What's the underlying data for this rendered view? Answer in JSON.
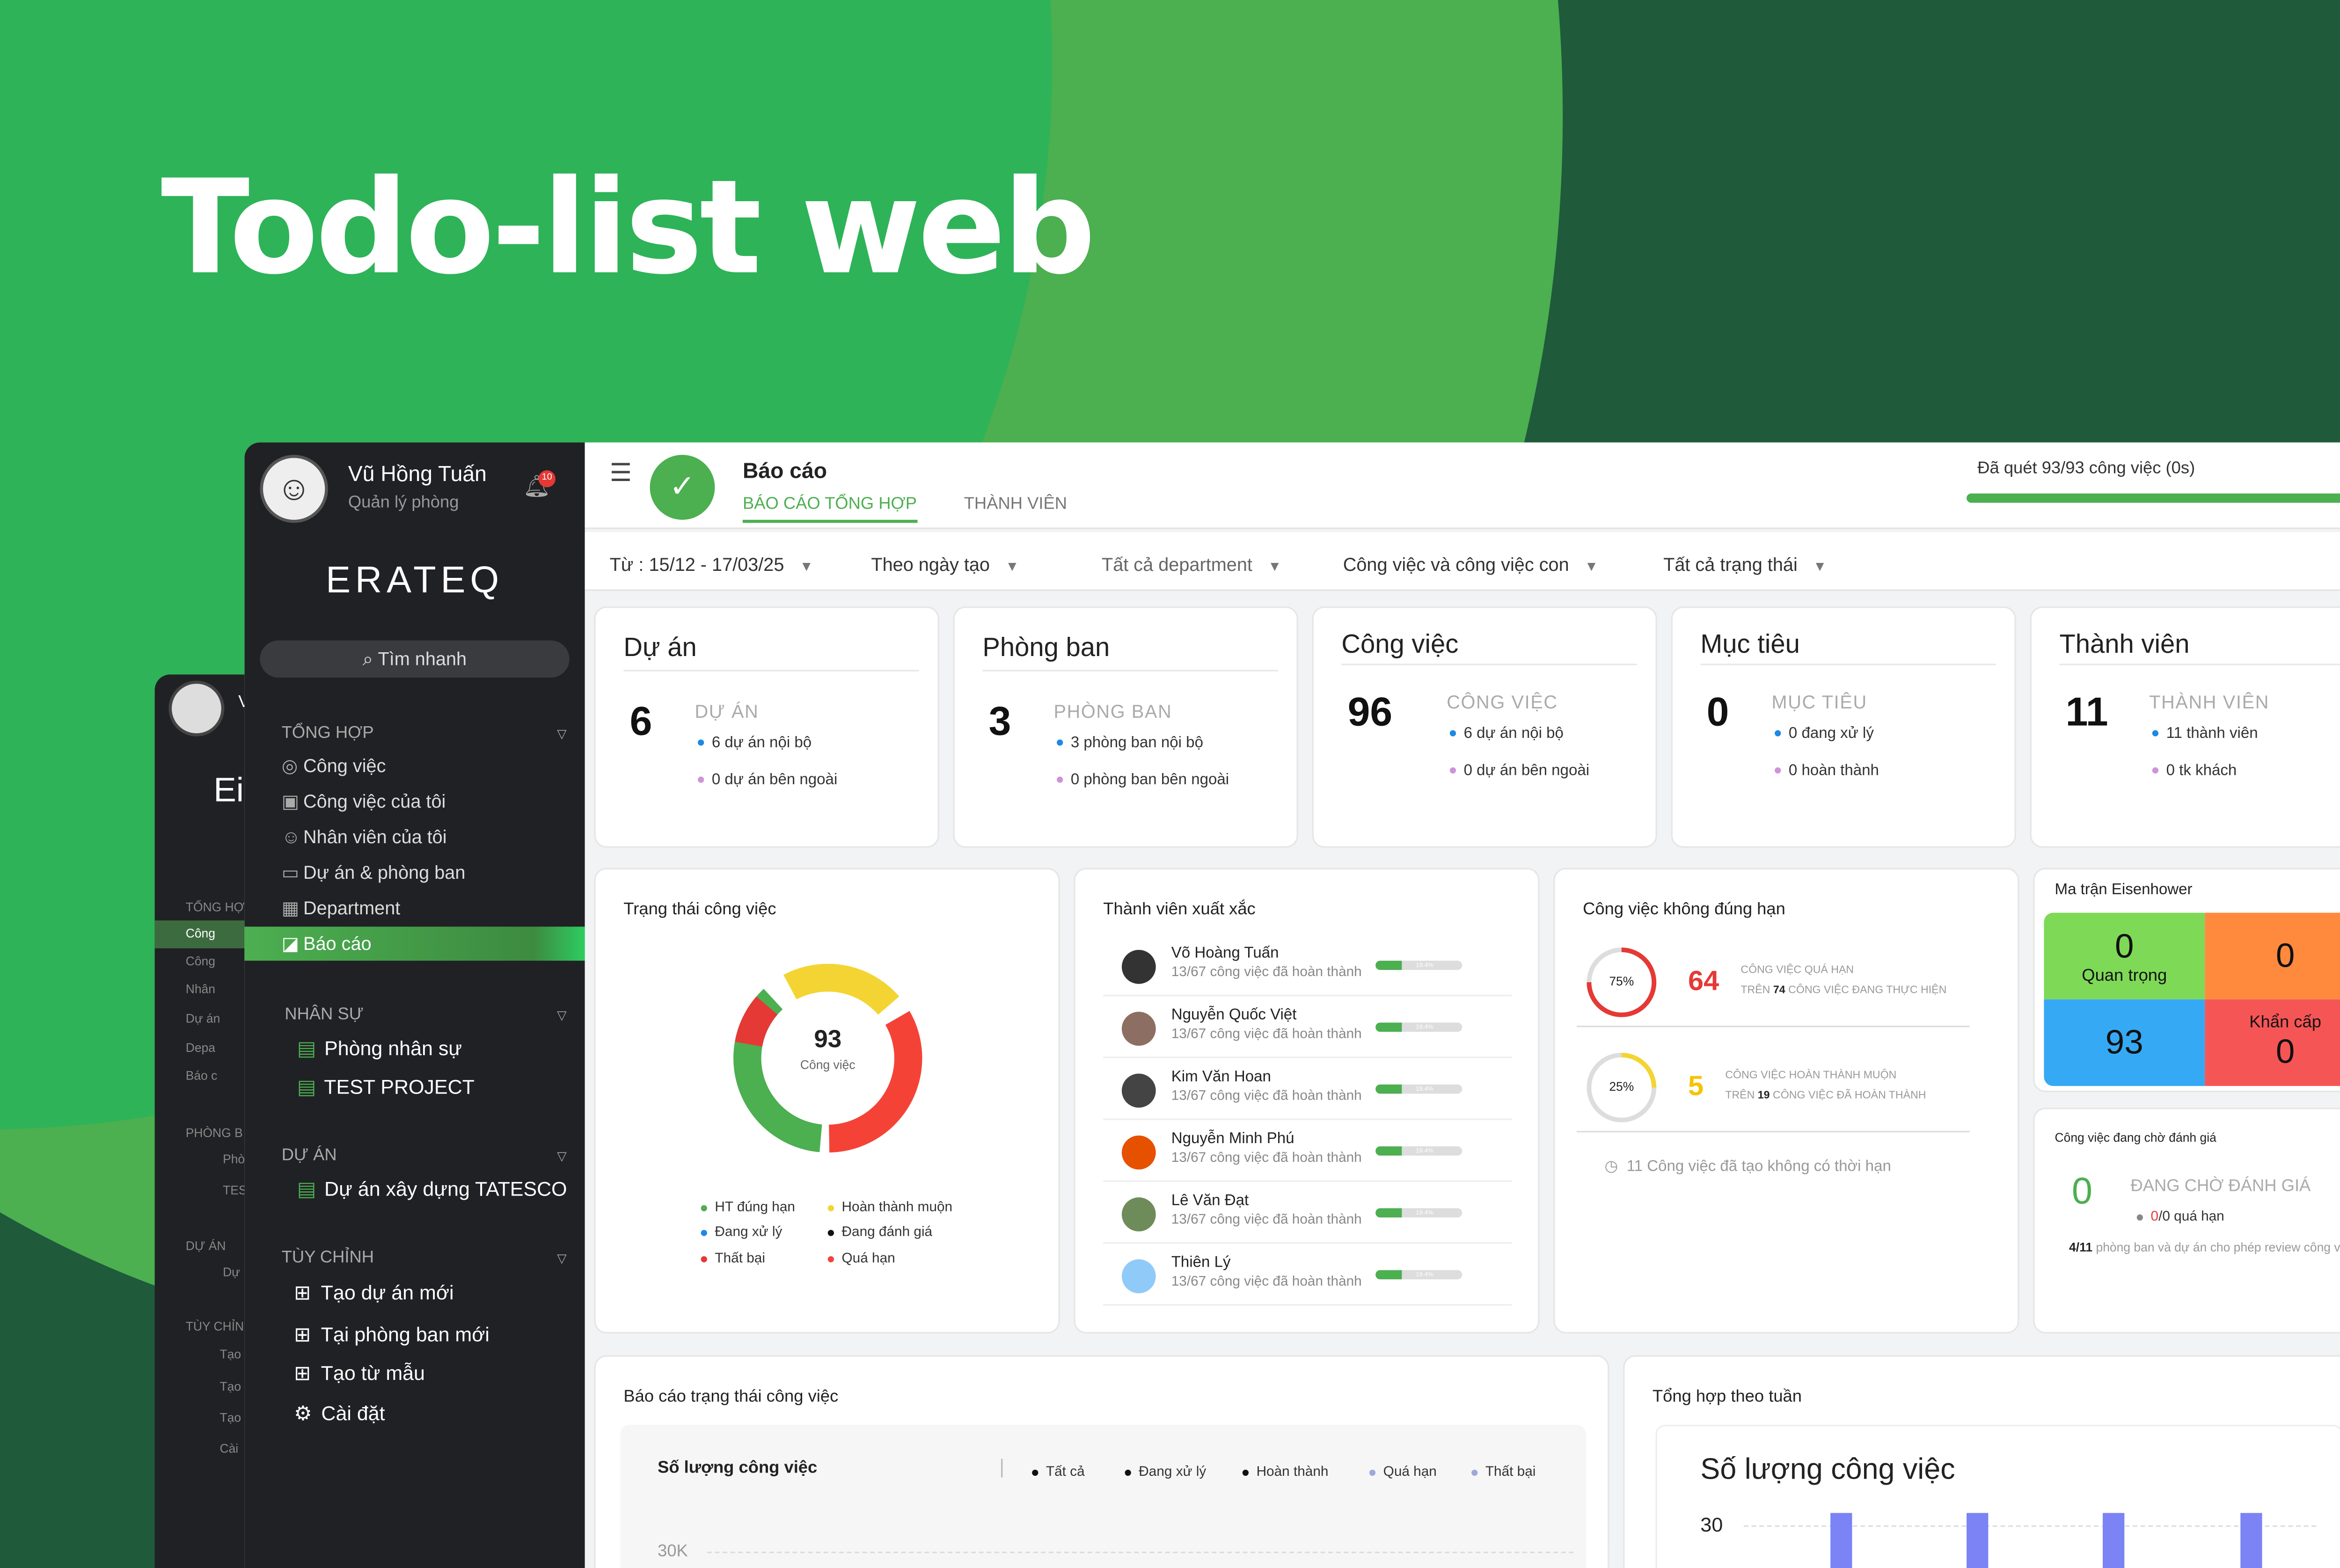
{
  "hero_title": "Todo-list web",
  "back_window": {
    "labels": [
      "Vi",
      "Ei",
      "TỔNG HỢ",
      "Công",
      "Công",
      "Nhân",
      "Dự án",
      "Depa",
      "Báo c",
      "PHÒNG B",
      "Phò",
      "TES",
      "DỰ ÁN",
      "Dự",
      "TÙY CHỈN",
      "Tạo",
      "Tạo",
      "Tạo",
      "Cài"
    ]
  },
  "user": {
    "name": "Vũ Hồng Tuấn",
    "role": "Quản lý phòng",
    "avatar_icon": "cartoon-face-avatar",
    "notif_count": "10"
  },
  "brand": "ERATEQ",
  "search_label": "Tìm nhanh",
  "sidebar": {
    "section_general": "TỔNG HỢP",
    "general_items": [
      "Công việc",
      "Công việc của tôi",
      "Nhân viên của tôi",
      "Dự án & phòng ban",
      "Department",
      "Báo cáo"
    ],
    "section_hr": "NHÂN SỰ",
    "hr_items": [
      "Phòng nhân sự",
      "TEST PROJECT"
    ],
    "section_projects": "DỰ ÁN",
    "project_items": [
      "Dự án xây dựng TATESCO"
    ],
    "section_custom": "TÙY CHỈNH",
    "custom_items": [
      "Tạo dự án mới",
      "Tại phòng ban mới",
      "Tạo từ mẫu",
      "Cài đặt"
    ]
  },
  "header": {
    "title": "Báo cáo",
    "tabs": [
      "BÁO CÁO TỔNG HỢP",
      "THÀNH VIÊN"
    ],
    "scan_status": "Đã quét 93/93 công việc (0s)",
    "scan_progress": 1.0
  },
  "filters": {
    "date_range": "Từ : 15/12 - 17/03/25",
    "date_type": "Theo ngày tạo",
    "department": "Tất cả department",
    "task_scope": "Công việc và công việc con",
    "status": "Tất cả trạng thái"
  },
  "stats": [
    {
      "title": "Dự án",
      "num": "6",
      "label": "DỰ ÁN",
      "s1": "6 dự án nội bộ",
      "s2": "0 dự án bên ngoài"
    },
    {
      "title": "Phòng ban",
      "num": "3",
      "label": "PHÒNG BAN",
      "s1": "3 phòng ban nội bộ",
      "s2": "0 phòng ban bên ngoài"
    },
    {
      "title": "Công việc",
      "num": "96",
      "label": "CÔNG VIỆC",
      "s1": "6 dự án nội bộ",
      "s2": "0 dự án bên ngoài"
    },
    {
      "title": "Mục tiêu",
      "num": "0",
      "label": "MỤC TIÊU",
      "s1": "0 đang xử lý",
      "s2": "0 hoàn thành"
    },
    {
      "title": "Thành viên",
      "num": "11",
      "label": "THÀNH VIÊN",
      "s1": "11 thành viên",
      "s2": "0 tk khách"
    }
  ],
  "task_status": {
    "title": "Trạng thái công việc",
    "total": "93",
    "total_label": "Công việc",
    "legend": [
      "HT đúng hạn",
      "Hoàn thành muộn",
      "Đang xử lý",
      "Đang đánh giá",
      "Thất bại",
      "Quá hạn"
    ],
    "colors": {
      "on_time": "#4caf50",
      "late": "#f4d433",
      "failed": "#e53935",
      "overdue": "#f44336"
    }
  },
  "top_members": {
    "title": "Thành viên xuất xắc",
    "members": [
      {
        "name": "Võ Hoàng Tuấn",
        "sub": "13/67 công việc đã hoàn thành",
        "pct": "19.4%"
      },
      {
        "name": "Nguyễn Quốc Việt",
        "sub": "13/67 công việc đã hoàn thành",
        "pct": "19.4%"
      },
      {
        "name": "Kim Văn Hoan",
        "sub": "13/67 công việc đã hoàn thành",
        "pct": "19.4%"
      },
      {
        "name": "Nguyễn Minh Phú",
        "sub": "13/67 công việc đã hoàn thành",
        "pct": "19.4%"
      },
      {
        "name": "Lê Văn Đạt",
        "sub": "13/67 công việc đã hoàn thành",
        "pct": "19.4%"
      },
      {
        "name": "Thiên Lý",
        "sub": "13/67 công việc đã hoàn thành",
        "pct": "19.4%"
      }
    ]
  },
  "ontime": {
    "title": "Công việc không đúng hạn",
    "overdue": {
      "pct": "75%",
      "value": "64",
      "line1": "CÔNG VIỆC QUÁ HẠN",
      "line2_pre": "TRÊN",
      "line2_num": "74",
      "line2_post": "CÔNG VIỆC ĐANG THỰC HIỆN"
    },
    "late": {
      "pct": "25%",
      "value": "5",
      "line1": "CÔNG VIỆC HOÀN THÀNH MUỘN",
      "line2_pre": "TRÊN",
      "line2_num": "19",
      "line2_post": "CÔNG VIỆC ĐÃ HOÀN THÀNH"
    },
    "no_deadline": "11 Công việc đã tạo không có thời hạn"
  },
  "eisenhower": {
    "title": "Ma trận Eisenhower",
    "q1": "0",
    "q1_label": "Quan trọng",
    "q2": "0",
    "q3": "93",
    "q4": "0",
    "q4_label": "Khẩn cấp"
  },
  "review": {
    "title": "Công việc đang chờ đánh giá",
    "num": "0",
    "label": "ĐANG CHỜ ĐÁNH GIÁ",
    "overdue_pre": "0",
    "overdue_post": "/0 quá hạn",
    "note_bold": "4/11",
    "note": "phòng ban và dự án cho phép review công việc"
  },
  "status_report": {
    "title": "Báo cáo trạng thái công việc",
    "chart_title": "Số lượng công việc",
    "legend": [
      "Tất cả",
      "Đang xử lý",
      "Hoàn thành",
      "Quá hạn",
      "Thất bại"
    ],
    "ytick": "30K"
  },
  "weekly": {
    "title": "Tổng hợp theo tuần",
    "chart_title": "Số lượng công việc",
    "ytick": "30"
  }
}
